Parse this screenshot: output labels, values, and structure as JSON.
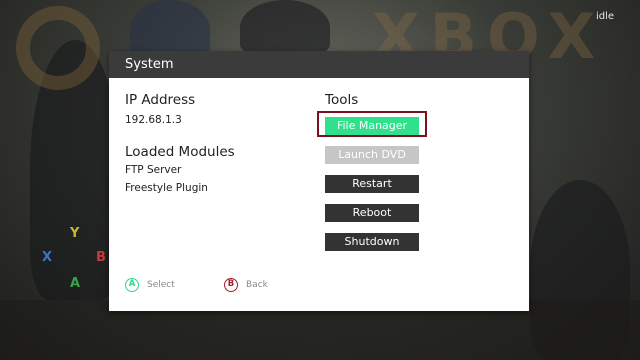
{
  "background": {
    "status_text": "idle"
  },
  "dialog": {
    "title": "System",
    "ip_section": {
      "heading": "IP Address",
      "value": "192.68.1.3"
    },
    "modules_section": {
      "heading": "Loaded Modules",
      "items": [
        "FTP Server",
        "Freestyle Plugin"
      ]
    },
    "tools_section": {
      "heading": "Tools",
      "buttons": [
        {
          "label": "File Manager",
          "state": "focused"
        },
        {
          "label": "Launch DVD",
          "state": "disabled"
        },
        {
          "label": "Restart",
          "state": "normal"
        },
        {
          "label": "Reboot",
          "state": "normal"
        },
        {
          "label": "Shutdown",
          "state": "normal"
        }
      ]
    },
    "footer": {
      "select": {
        "button_glyph": "A",
        "label": "Select",
        "icon": "a-button-icon"
      },
      "back": {
        "button_glyph": "B",
        "label": "Back",
        "icon": "b-button-icon"
      }
    }
  },
  "colors": {
    "accent_focus": "#2fe08d",
    "focus_ring": "#7a1020",
    "header_bg": "#3b3b3b",
    "button_bg": "#333333",
    "disabled_bg": "#c6c6c6",
    "a_button": "#34d48a",
    "b_button": "#a3202c"
  }
}
